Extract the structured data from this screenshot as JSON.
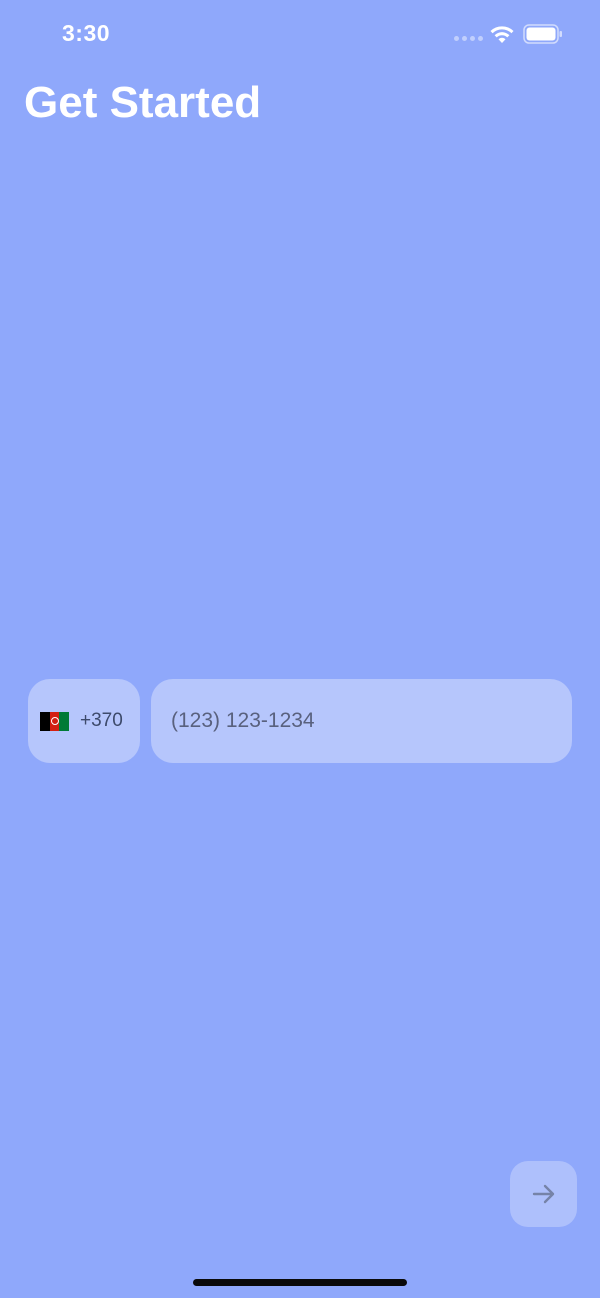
{
  "status_bar": {
    "time": "3:30",
    "icons": [
      "signal-dots-icon",
      "wifi-icon",
      "battery-icon"
    ]
  },
  "header": {
    "title": "Get Started"
  },
  "phone_form": {
    "country": {
      "flag_icon": "afghanistan-flag-icon",
      "dial_code": "+370"
    },
    "phone_input": {
      "placeholder": "(123) 123-1234",
      "value": ""
    }
  },
  "next_button": {
    "icon": "arrow-right-icon"
  },
  "colors": {
    "background": "#8FA8FB",
    "title": "#FFFFFF",
    "field_background": "rgba(255,255,255,0.35)",
    "field_text": "#3D4A6B",
    "home_indicator": "#0A0A0A"
  }
}
